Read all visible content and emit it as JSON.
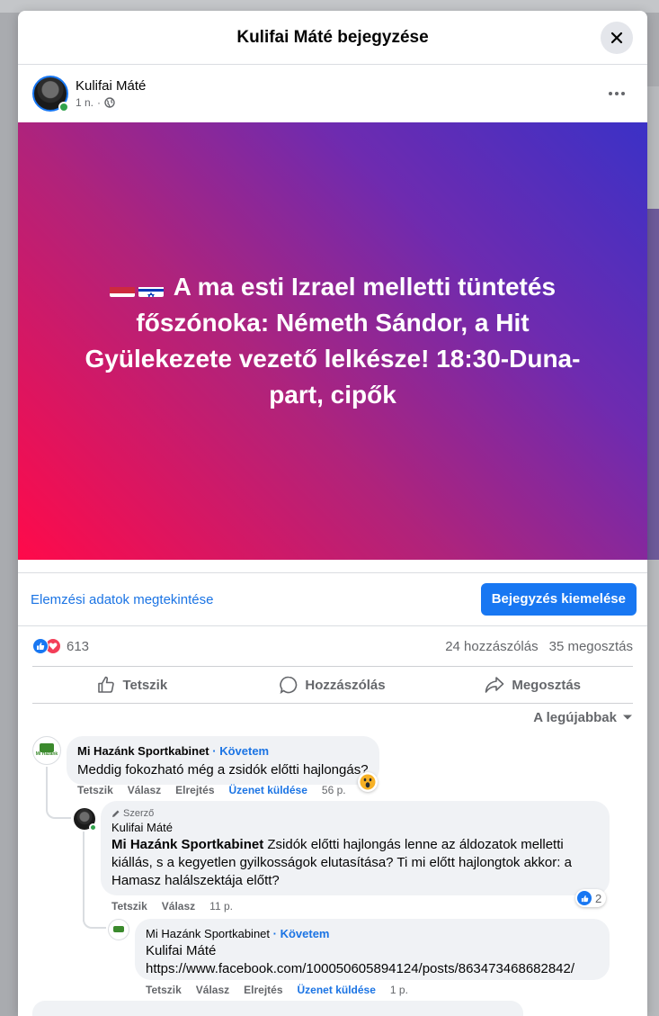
{
  "modal": {
    "title": "Kulifai Máté bejegyzése"
  },
  "post": {
    "author": "Kulifai Máté",
    "time": "1 n.",
    "separator": "·",
    "text": "A ma esti Izrael melletti tüntetés főszónoka: Németh Sándor, a Hit Gyülekezete vezető lelkésze! 18:30-Duna-part, cipők",
    "gradient_colors": [
      "#ff0a4a",
      "#b0237b",
      "#6e2bb0",
      "#3b31c6"
    ]
  },
  "promo": {
    "insights_label": "Elemzési adatok megtekintése",
    "boost_label": "Bejegyzés kiemelése"
  },
  "stats": {
    "reaction_count": "613",
    "comments": "24 hozzászólás",
    "shares": "35 megosztás"
  },
  "actions": {
    "like": "Tetszik",
    "comment": "Hozzászólás",
    "share": "Megosztás"
  },
  "sort": {
    "label": "A legújabbak"
  },
  "comments": [
    {
      "author": "Mi Hazánk Sportkabinet",
      "follow": "Követem",
      "text": "Meddig fokozható még a zsidók előtti hajlongás?",
      "reaction": "wow",
      "actions": {
        "like": "Tetszik",
        "reply": "Válasz",
        "hide": "Elrejtés",
        "message": "Üzenet küldése",
        "time": "56 p."
      }
    },
    {
      "author_tag": "Szerző",
      "author": "Kulifai Máté",
      "mention": "Mi Hazánk Sportkabinet",
      "text": " Zsidók előtti hajlongás lenne az áldozatok melletti kiállás, s a kegyetlen gyilkosságok elutasítása? Ti mi előtt hajlongtok akkor: a Hamasz halálszektája előtt?",
      "like_count": "2",
      "actions": {
        "like": "Tetszik",
        "reply": "Válasz",
        "time": "11 p."
      }
    },
    {
      "author": "Mi Hazánk Sportkabinet",
      "follow": "Követem",
      "mention": "Kulifai Máté",
      "text": "https://www.facebook.com/100050605894124/posts/863473468682842/",
      "actions": {
        "like": "Tetszik",
        "reply": "Válasz",
        "hide": "Elrejtés",
        "message": "Üzenet küldése",
        "time": "1 p."
      }
    }
  ],
  "avatar_logo_text": "Mi Hazánk",
  "colors": {
    "accent": "#1877f2",
    "link": "#1b74e4",
    "secondary_text": "#65676b",
    "bubble": "#f0f2f5"
  }
}
